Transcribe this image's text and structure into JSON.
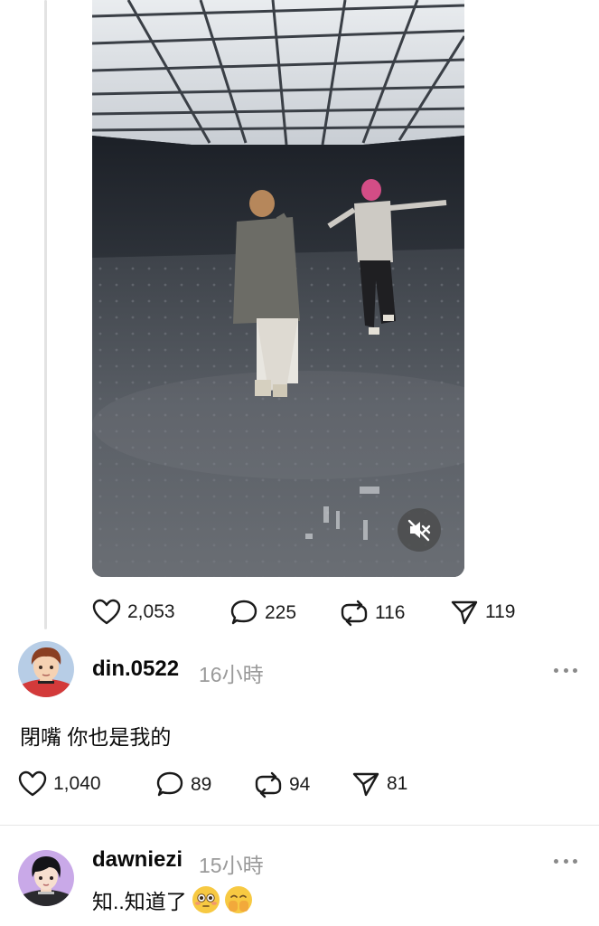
{
  "post": {
    "video": {
      "muted": true,
      "mute_icon": "speaker-muted-icon"
    },
    "actions": {
      "likes": "2,053",
      "comments": "225",
      "reposts": "116",
      "shares": "119"
    }
  },
  "replies": [
    {
      "username": "din.0522",
      "time": "16小時",
      "text": "閉嘴 你也是我的",
      "likes": "1,040",
      "comments": "89",
      "reposts": "94",
      "shares": "81"
    },
    {
      "username": "dawniezi",
      "time": "15小時",
      "text": "知..知道了",
      "emojis": [
        "flushed-face-icon",
        "face-with-hand-over-mouth-icon"
      ]
    }
  ],
  "colors": {
    "text": "#0a0a0a",
    "muted_text": "#9a9a9a",
    "divider": "#e6e6e6",
    "thread_line": "#e3e3e3"
  }
}
